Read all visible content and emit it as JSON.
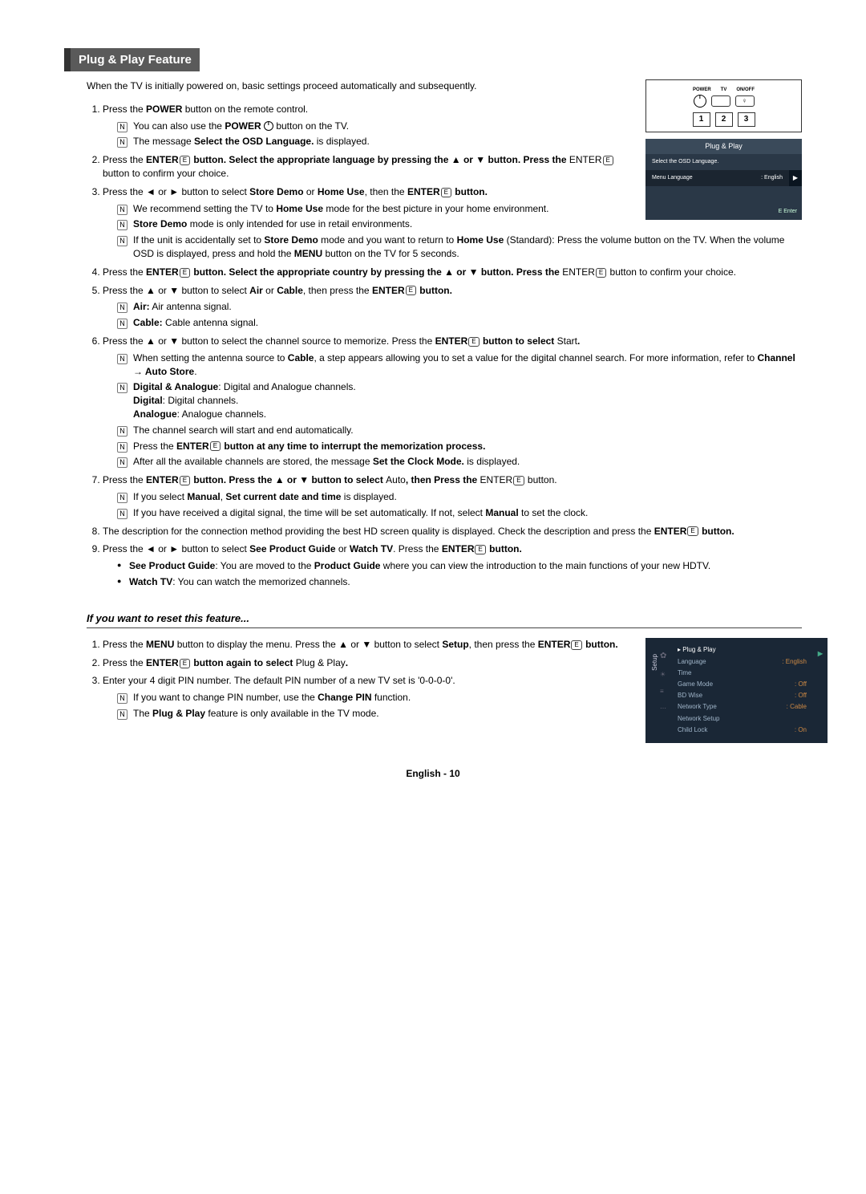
{
  "title": "Plug & Play Feature",
  "intro": "When the TV is initially powered on, basic settings proceed automatically and subsequently.",
  "remote": {
    "labels": {
      "power": "POWER",
      "tv": "TV",
      "onoff": "ON/OFF"
    },
    "nums": [
      "1",
      "2",
      "3"
    ]
  },
  "osd1": {
    "title": "Plug & Play",
    "prompt": "Select the OSD Language.",
    "row_label": "Menu Language",
    "row_value": ": English",
    "arrow": "▶",
    "foot": "E Enter"
  },
  "steps": [
    {
      "text_parts": [
        "Press the ",
        "POWER",
        " button on the remote control."
      ],
      "subs": [
        {
          "parts": [
            "You can also use the ",
            "POWER",
            " ",
            "{POWERICON}",
            " button on the TV."
          ]
        },
        {
          "parts": [
            "The message ",
            "Select the OSD Language.",
            " is displayed."
          ]
        }
      ]
    },
    {
      "text_parts": [
        "Press the ",
        "ENTER",
        "{ENTERICON}",
        " button. Select the appropriate language by pressing the ▲ or ▼ button. Press the ",
        "ENTER",
        "{ENTERICON}",
        " button to confirm your choice."
      ]
    },
    {
      "text_parts": [
        "Press the ◄ or ► button to select ",
        "Store Demo",
        " or ",
        "Home Use",
        ", then the ",
        "ENTER",
        "{ENTERICON}",
        " button."
      ],
      "subs": [
        {
          "parts": [
            "We recommend setting the TV to ",
            "Home Use",
            " mode for the best picture in your home environment."
          ]
        },
        {
          "parts": [
            "",
            "Store Demo",
            " mode is only intended for use in retail environments."
          ]
        },
        {
          "parts": [
            "If the unit is accidentally set to ",
            "Store Demo",
            " mode and you want to return to ",
            "Home Use",
            " (Standard): Press the volume button on the TV. When the volume OSD is displayed, press and hold the ",
            "MENU",
            " button on the TV for 5 seconds."
          ]
        }
      ]
    },
    {
      "text_parts": [
        "Press the ",
        "ENTER",
        "{ENTERICON}",
        " button. Select the appropriate country by pressing the ▲ or ▼ button. Press the ",
        "ENTER",
        "{ENTERICON}",
        " button to confirm your choice."
      ]
    },
    {
      "text_parts": [
        "Press the ▲ or ▼ button to select ",
        "Air",
        " or ",
        "Cable",
        ", then press the ",
        "ENTER",
        "{ENTERICON}",
        " button."
      ],
      "subs": [
        {
          "parts": [
            "",
            "Air:",
            " Air antenna signal."
          ]
        },
        {
          "parts": [
            "",
            "Cable:",
            " Cable antenna signal."
          ]
        }
      ]
    },
    {
      "text_parts": [
        "Press the ▲ or ▼ button to select the channel source to memorize. Press the ",
        "ENTER",
        "{ENTERICON}",
        " button to select ",
        "Start",
        "."
      ],
      "subs": [
        {
          "parts": [
            "When setting the antenna source to ",
            "Cable",
            ", a step appears allowing you to set a value for the digital channel search. For more information, refer to ",
            "Channel → Auto Store",
            "."
          ]
        },
        {
          "parts": [
            "",
            "Digital & Analogue",
            ": Digital and Analogue channels.\n",
            "Digital",
            ": Digital channels.\n",
            "Analogue",
            ": Analogue channels."
          ]
        },
        {
          "parts": [
            "The channel search will start and end automatically."
          ]
        },
        {
          "parts": [
            "Press the ",
            "ENTER",
            "{ENTERICON}",
            " button at any time to interrupt the memorization process."
          ]
        },
        {
          "parts": [
            "After all the available channels are stored, the message ",
            "Set the Clock Mode.",
            " is displayed."
          ]
        }
      ]
    },
    {
      "text_parts": [
        "Press the ",
        "ENTER",
        "{ENTERICON}",
        " button. Press the ▲ or ▼ button to select ",
        "Auto",
        ", then Press the ",
        "ENTER",
        "{ENTERICON}",
        " button."
      ],
      "subs": [
        {
          "parts": [
            "If you select ",
            "Manual",
            ", ",
            "Set current date and time",
            " is displayed."
          ]
        },
        {
          "parts": [
            "If you have received a digital signal, the time will be set automatically. If not, select ",
            "Manual",
            " to set the clock."
          ]
        }
      ]
    },
    {
      "text_parts": [
        "The description for the connection method providing the best HD screen quality is displayed. Check the description and press the ",
        "ENTER",
        "{ENTERICON}",
        " button."
      ]
    },
    {
      "text_parts": [
        "Press the ◄ or ► button to select ",
        "See Product Guide",
        " or ",
        "Watch TV",
        ". Press the ",
        "ENTER",
        "{ENTERICON}",
        " button."
      ],
      "bullets": [
        {
          "parts": [
            "",
            "See Product Guide",
            ": You are moved to the ",
            "Product Guide",
            " where you can view the introduction to the main functions of your new HDTV."
          ]
        },
        {
          "parts": [
            "",
            "Watch TV",
            ": You can watch the memorized channels."
          ]
        }
      ]
    }
  ],
  "reset": {
    "title": "If you want to reset this feature...",
    "steps": [
      {
        "text_parts": [
          "Press the ",
          "MENU",
          " button to display the menu. Press the ▲ or ▼ button to select ",
          "Setup",
          ", then press the ",
          "ENTER",
          "{ENTERICON}",
          " button."
        ]
      },
      {
        "text_parts": [
          "Press the ",
          "ENTER",
          "{ENTERICON}",
          " button again to select ",
          "Plug & Play",
          "."
        ]
      },
      {
        "text_parts": [
          "Enter your 4 digit PIN number. The default PIN number of a new TV set is '0-0-0-0'."
        ],
        "subs": [
          {
            "parts": [
              "If you want to change PIN number, use the ",
              "Change PIN",
              " function."
            ]
          },
          {
            "parts": [
              "The ",
              "Plug & Play",
              " feature is only available in the TV mode."
            ]
          }
        ]
      }
    ]
  },
  "setup_osd": {
    "side": "Setup",
    "first": {
      "label": "Plug & Play",
      "arrow": "▶"
    },
    "rows": [
      {
        "label": "Language",
        "value": ": English"
      },
      {
        "label": "Time",
        "value": ""
      },
      {
        "label": "Game Mode",
        "value": ": Off"
      },
      {
        "label": "BD Wise",
        "value": ": Off"
      },
      {
        "label": "Network Type",
        "value": ": Cable"
      },
      {
        "label": "Network Setup",
        "value": ""
      },
      {
        "label": "Child Lock",
        "value": ": On"
      }
    ]
  },
  "footer": "English - 10"
}
